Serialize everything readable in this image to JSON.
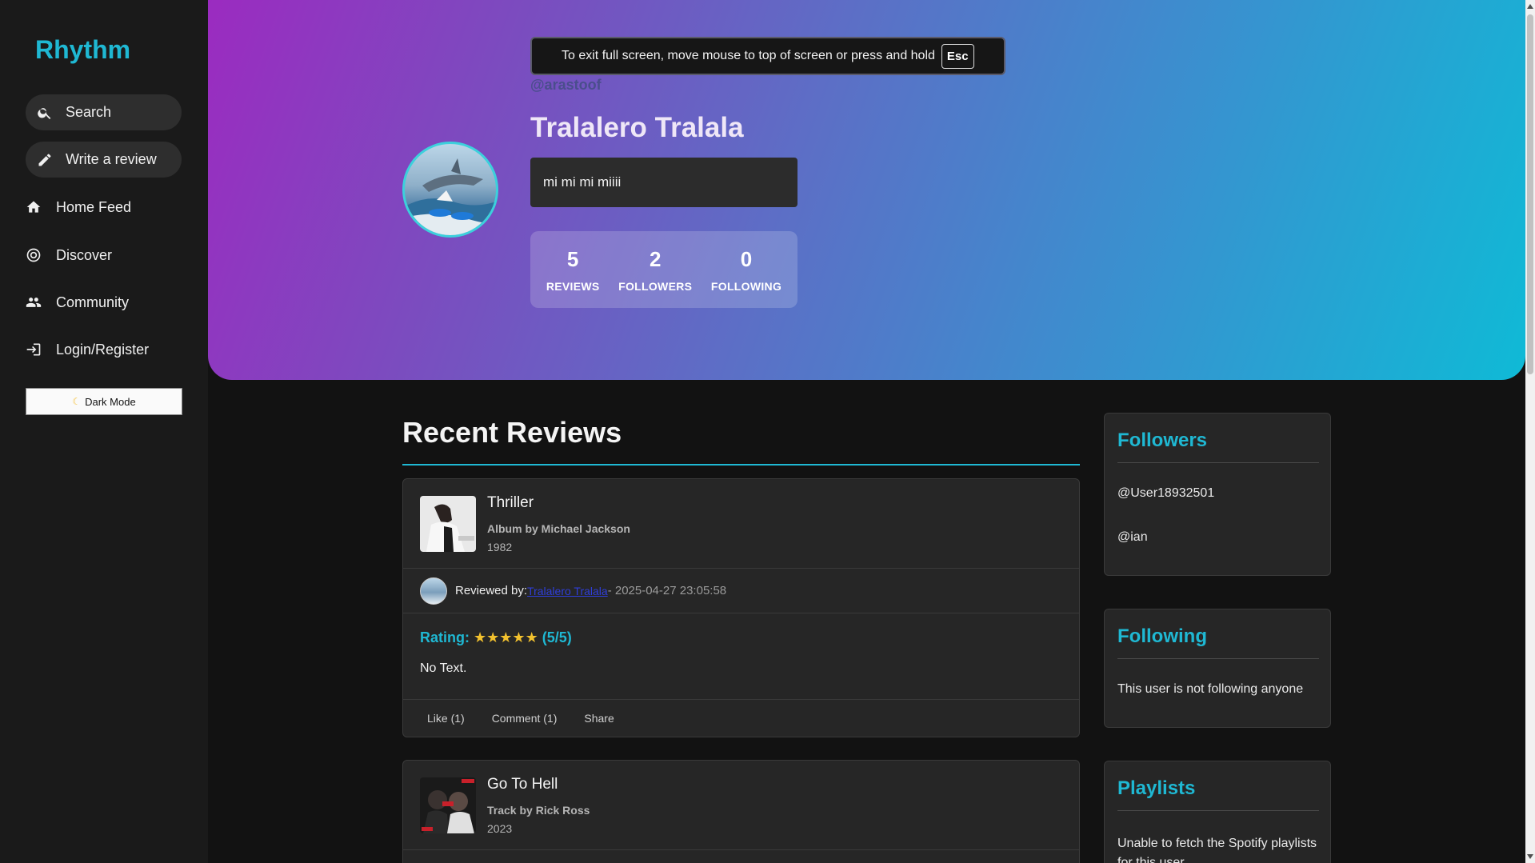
{
  "sidebar": {
    "logo": "Rhythm",
    "search_label": "Search",
    "write_review_label": "Write a review",
    "nav": {
      "home": "Home Feed",
      "discover": "Discover",
      "community": "Community",
      "login": "Login/Register"
    },
    "dark_mode_label": "Dark Mode"
  },
  "fullscreen_toast": {
    "message": "To exit full screen, move mouse to top of screen or press and hold",
    "key": "Esc"
  },
  "profile": {
    "handle": "@arastoof",
    "name": "Tralalero Tralala",
    "bio": "mi mi mi miiii",
    "stats": {
      "reviews": "5",
      "reviews_label": "REVIEWS",
      "followers": "2",
      "followers_label": "FOLLOWERS",
      "following": "0",
      "following_label": "FOLLOWING"
    }
  },
  "recent_reviews": {
    "title": "Recent Reviews",
    "items": [
      {
        "title": "Thriller",
        "subtitle": "Album by Michael Jackson",
        "year": "1982",
        "reviewed_by_label": "Reviewed by:",
        "reviewer": "Tralalero Tralala",
        "timestamp": "- 2025-04-27 23:05:58",
        "rating_label": "Rating:",
        "stars": "★★★★★",
        "rating_value": "(5/5)",
        "text": "No Text.",
        "like_label": "Like (1)",
        "comment_label": "Comment (1)",
        "share_label": "Share"
      },
      {
        "title": "Go To Hell",
        "subtitle": "Track by Rick Ross",
        "year": "2023"
      }
    ]
  },
  "followers_panel": {
    "title": "Followers",
    "users": [
      "@User18932501",
      "@ian"
    ]
  },
  "following_panel": {
    "title": "Following",
    "empty_text": "This user is not following anyone"
  },
  "playlists_panel": {
    "title": "Playlists",
    "message": "Unable to fetch the Spotify playlists for this user"
  },
  "colors": {
    "accent": "#1fb8d3",
    "background": "#121212",
    "sidebar": "#1a1a1a",
    "card": "#262626",
    "star": "#f2c12e"
  }
}
